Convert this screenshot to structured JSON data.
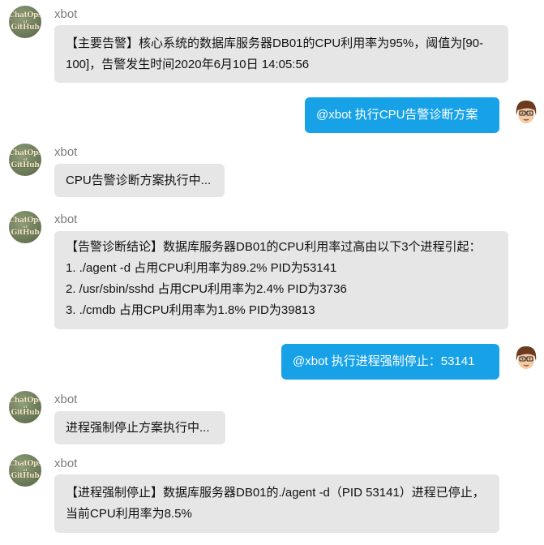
{
  "bot_name": "xbot",
  "avatar_text": [
    "ChatOps",
    "of",
    "GitHub"
  ],
  "messages": [
    {
      "side": "left",
      "lines": [
        "【主要告警】核心系统的数据库服务器DB01的CPU利用率为95%，阈值为[90-100]，告警发生时间2020年6月10日 14:05:56"
      ]
    },
    {
      "side": "right",
      "text": "@xbot 执行CPU告警诊断方案"
    },
    {
      "side": "left",
      "lines": [
        "CPU告警诊断方案执行中..."
      ]
    },
    {
      "side": "left",
      "lines": [
        "【告警诊断结论】数据库服务器DB01的CPU利用率过高由以下3个进程引起：",
        "1. ./agent -d 占用CPU利用率为89.2% PID为53141",
        "2. /usr/sbin/sshd 占用CPU利用率为2.4% PID为3736",
        "3. ./cmdb 占用CPU利用率为1.8% PID为39813"
      ]
    },
    {
      "side": "right",
      "text": "@xbot 执行进程强制停止：53141"
    },
    {
      "side": "left",
      "lines": [
        "进程强制停止方案执行中..."
      ]
    },
    {
      "side": "left",
      "lines": [
        "【进程强制停止】数据库服务器DB01的./agent -d（PID 53141）进程已停止，当前CPU利用率为8.5%"
      ]
    }
  ],
  "colors": {
    "bot_bubble": "#e6e6e6",
    "user_bubble": "#17a2e8"
  }
}
